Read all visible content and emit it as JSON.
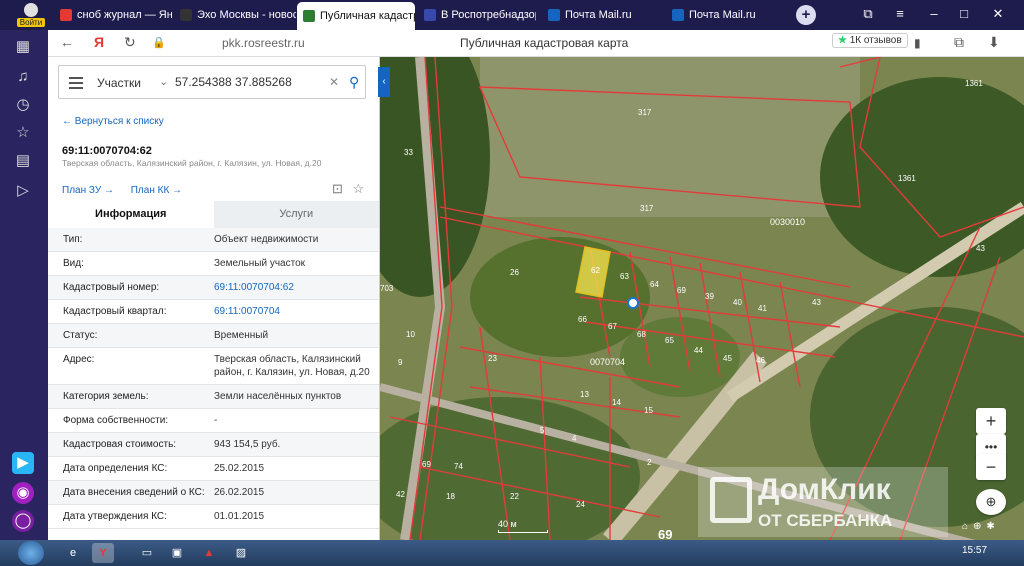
{
  "browser": {
    "login_label": "Войти",
    "tabs": [
      {
        "title": "сноб журнал — Янд",
        "color": "#e53935"
      },
      {
        "title": "Эхо Москвы - новос",
        "color": "#333333"
      },
      {
        "title": "Публичная кадастр",
        "color": "#2e7d32"
      },
      {
        "title": "В Роспотребнадзор",
        "color": "#3949ab"
      },
      {
        "title": "Почта Mail.ru",
        "color": "#1565c0"
      },
      {
        "title": "Почта Mail.ru",
        "color": "#1565c0"
      }
    ],
    "url": "pkk.rosreestr.ru",
    "page_title": "Публичная кадастровая карта",
    "reviews": "1К отзывов"
  },
  "search": {
    "category": "Участки",
    "query": "57.254388 37.885268"
  },
  "panel": {
    "back_link": "← Вернуться к списку",
    "cad_number": "69:11:0070704:62",
    "cad_address": "Тверская область, Калязинский район, г. Калязин, ул. Новая, д.20",
    "plan_zu": "План ЗУ →",
    "plan_kk": "План КК →",
    "tab_info": "Информация",
    "tab_services": "Услуги",
    "rows": [
      {
        "k": "Тип:",
        "v": "Объект недвижимости"
      },
      {
        "k": "Вид:",
        "v": "Земельный участок"
      },
      {
        "k": "Кадастровый номер:",
        "v": "69:11:0070704:62"
      },
      {
        "k": "Кадастровый квартал:",
        "v": "69:11:0070704"
      },
      {
        "k": "Статус:",
        "v": "Временный"
      },
      {
        "k": "Адрес:",
        "v": "Тверская область, Калязинский район, г. Калязин, ул. Новая, д.20"
      },
      {
        "k": "Категория земель:",
        "v": "Земли населённых пунктов"
      },
      {
        "k": "Форма собственности:",
        "v": "-"
      },
      {
        "k": "Кадастровая стоимость:",
        "v": "943 154,5 руб."
      },
      {
        "k": "Дата определения КС:",
        "v": "25.02.2015"
      },
      {
        "k": "Дата внесения сведений о КС:",
        "v": "26.02.2015"
      },
      {
        "k": "Дата утверждения КС:",
        "v": "01.01.2015"
      }
    ]
  },
  "map": {
    "labels": [
      "317",
      "317",
      "33",
      "1361",
      "1361",
      "0030010",
      "43",
      "26",
      "62",
      "63",
      "64",
      "69",
      "39",
      "40",
      "41",
      "43",
      "66",
      "67",
      "68",
      "65",
      "44",
      "45",
      "46",
      "0070704",
      "10",
      "9",
      "23",
      "13",
      "14",
      "15",
      "5",
      "4",
      "2",
      "69",
      "74",
      "18",
      "22",
      "24",
      "42",
      "703",
      "69"
    ],
    "scale": "40 м",
    "watermark_1": "ДомКлик",
    "watermark_2": "ОТ СБЕРБАНКА"
  },
  "taskbar": {
    "clock": "15:57"
  }
}
